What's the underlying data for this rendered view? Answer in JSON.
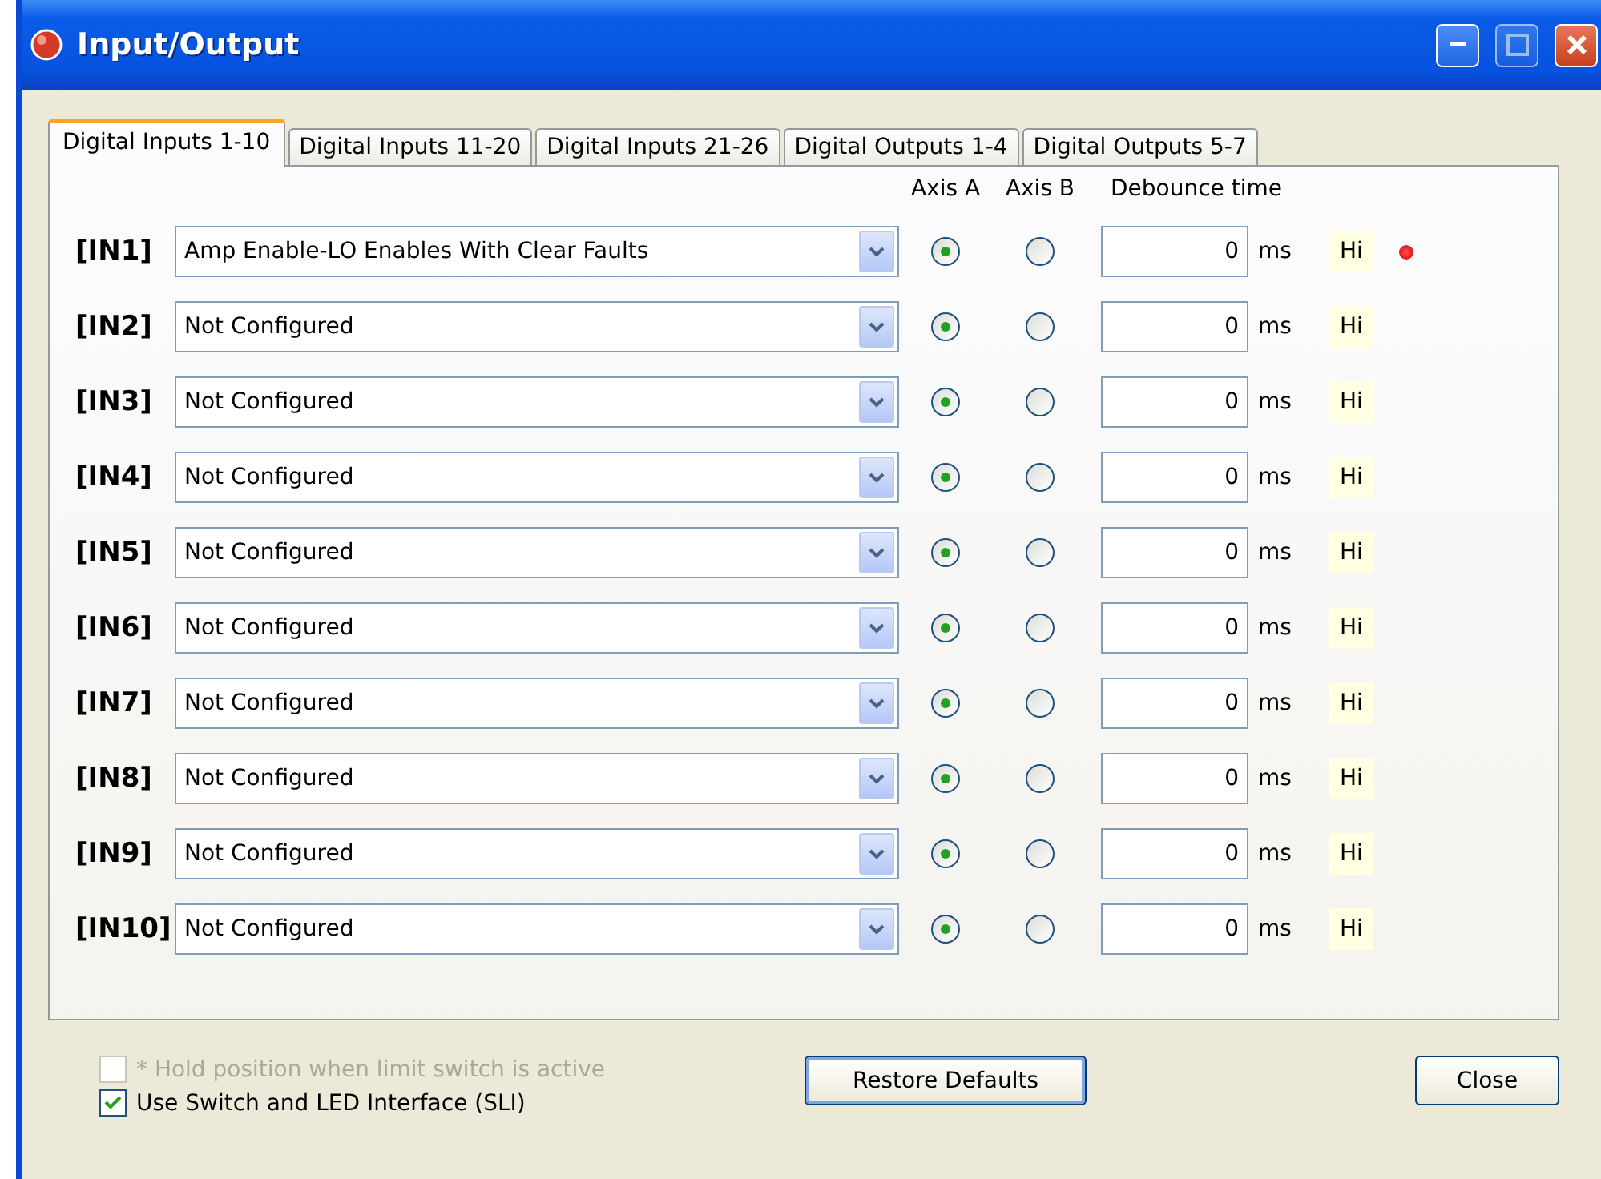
{
  "window": {
    "title": "Input/Output"
  },
  "tabs": [
    {
      "label": "Digital Inputs 1-10",
      "selected": true
    },
    {
      "label": "Digital Inputs 11-20",
      "selected": false
    },
    {
      "label": "Digital Inputs 21-26",
      "selected": false
    },
    {
      "label": "Digital Outputs 1-4",
      "selected": false
    },
    {
      "label": "Digital Outputs 5-7",
      "selected": false
    }
  ],
  "columns": [
    "Axis A",
    "Axis B",
    "Debounce time"
  ],
  "rows": [
    {
      "label": "[IN1]",
      "function": "Amp Enable-LO Enables With Clear Faults",
      "axis_a": true,
      "axis_b": false,
      "debounce": "0",
      "unit": "ms",
      "polarity": "Hi",
      "led_on": true
    },
    {
      "label": "[IN2]",
      "function": "Not Configured",
      "axis_a": true,
      "axis_b": false,
      "debounce": "0",
      "unit": "ms",
      "polarity": "Hi",
      "led_on": false
    },
    {
      "label": "[IN3]",
      "function": "Not Configured",
      "axis_a": true,
      "axis_b": false,
      "debounce": "0",
      "unit": "ms",
      "polarity": "Hi",
      "led_on": false
    },
    {
      "label": "[IN4]",
      "function": "Not Configured",
      "axis_a": true,
      "axis_b": false,
      "debounce": "0",
      "unit": "ms",
      "polarity": "Hi",
      "led_on": false
    },
    {
      "label": "[IN5]",
      "function": "Not Configured",
      "axis_a": true,
      "axis_b": false,
      "debounce": "0",
      "unit": "ms",
      "polarity": "Hi",
      "led_on": false
    },
    {
      "label": "[IN6]",
      "function": "Not Configured",
      "axis_a": true,
      "axis_b": false,
      "debounce": "0",
      "unit": "ms",
      "polarity": "Hi",
      "led_on": false
    },
    {
      "label": "[IN7]",
      "function": "Not Configured",
      "axis_a": true,
      "axis_b": false,
      "debounce": "0",
      "unit": "ms",
      "polarity": "Hi",
      "led_on": false
    },
    {
      "label": "[IN8]",
      "function": "Not Configured",
      "axis_a": true,
      "axis_b": false,
      "debounce": "0",
      "unit": "ms",
      "polarity": "Hi",
      "led_on": false
    },
    {
      "label": "[IN9]",
      "function": "Not Configured",
      "axis_a": true,
      "axis_b": false,
      "debounce": "0",
      "unit": "ms",
      "polarity": "Hi",
      "led_on": false
    },
    {
      "label": "[IN10]",
      "function": "Not Configured",
      "axis_a": true,
      "axis_b": false,
      "debounce": "0",
      "unit": "ms",
      "polarity": "Hi",
      "led_on": false
    }
  ],
  "options": [
    {
      "label": "* Hold position when limit switch is active",
      "checked": false,
      "disabled": true
    },
    {
      "label": "Use Switch and LED Interface (SLI)",
      "checked": true,
      "disabled": false
    }
  ],
  "buttons": [
    {
      "label": "Restore Defaults",
      "focused": true
    },
    {
      "label": "Close",
      "focused": false
    }
  ]
}
